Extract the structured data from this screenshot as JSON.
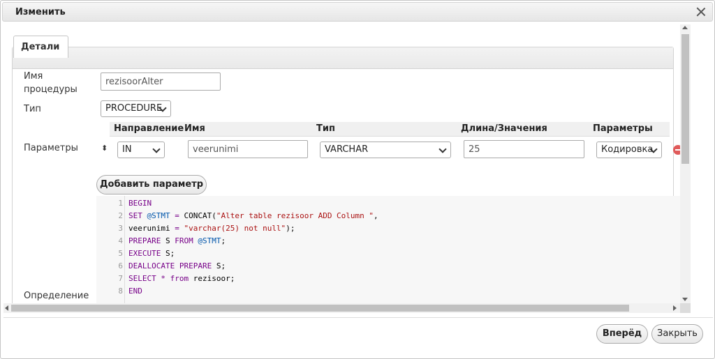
{
  "dialog": {
    "title": "Изменить"
  },
  "tab": {
    "label": "Детали"
  },
  "form": {
    "name_label": "Имя\nпроцедуры",
    "name_value": "rezisoorAlter",
    "type_label": "Тип",
    "type_value": "PROCEDURE",
    "params_label": "Параметры",
    "definition_label": "Определение"
  },
  "params_table": {
    "headers": [
      "Направление",
      "Имя",
      "Тип",
      "Длина/Значения",
      "Параметры"
    ],
    "row": {
      "direction": "IN",
      "name": "veerunimi",
      "type": "VARCHAR",
      "length": "25",
      "options": "Кодировка"
    }
  },
  "add_param_button": "Добавить параметр",
  "code": {
    "line_numbers": [
      "1",
      "2",
      "3",
      "4",
      "5",
      "6",
      "7",
      "8"
    ],
    "lines": [
      "BEGIN",
      "SET @STMT = CONCAT(\"Alter table rezisoor ADD Column \",",
      "veerunimi = \"varchar(25) not null\");",
      "PREPARE S FROM @STMT;",
      "EXECUTE S;",
      "DEALLOCATE PREPARE S;",
      "SELECT * from rezisoor;",
      "END"
    ]
  },
  "footer": {
    "forward_button": "Вперёд",
    "close_button": "Закрыть"
  },
  "icons": {
    "close": "close-icon",
    "sort": "sort-handle-icon",
    "remove": "remove-param-icon"
  },
  "colors": {
    "keyword": "#770088",
    "variable": "#0055aa",
    "string": "#aa1111",
    "remove": "#e05a5a"
  }
}
